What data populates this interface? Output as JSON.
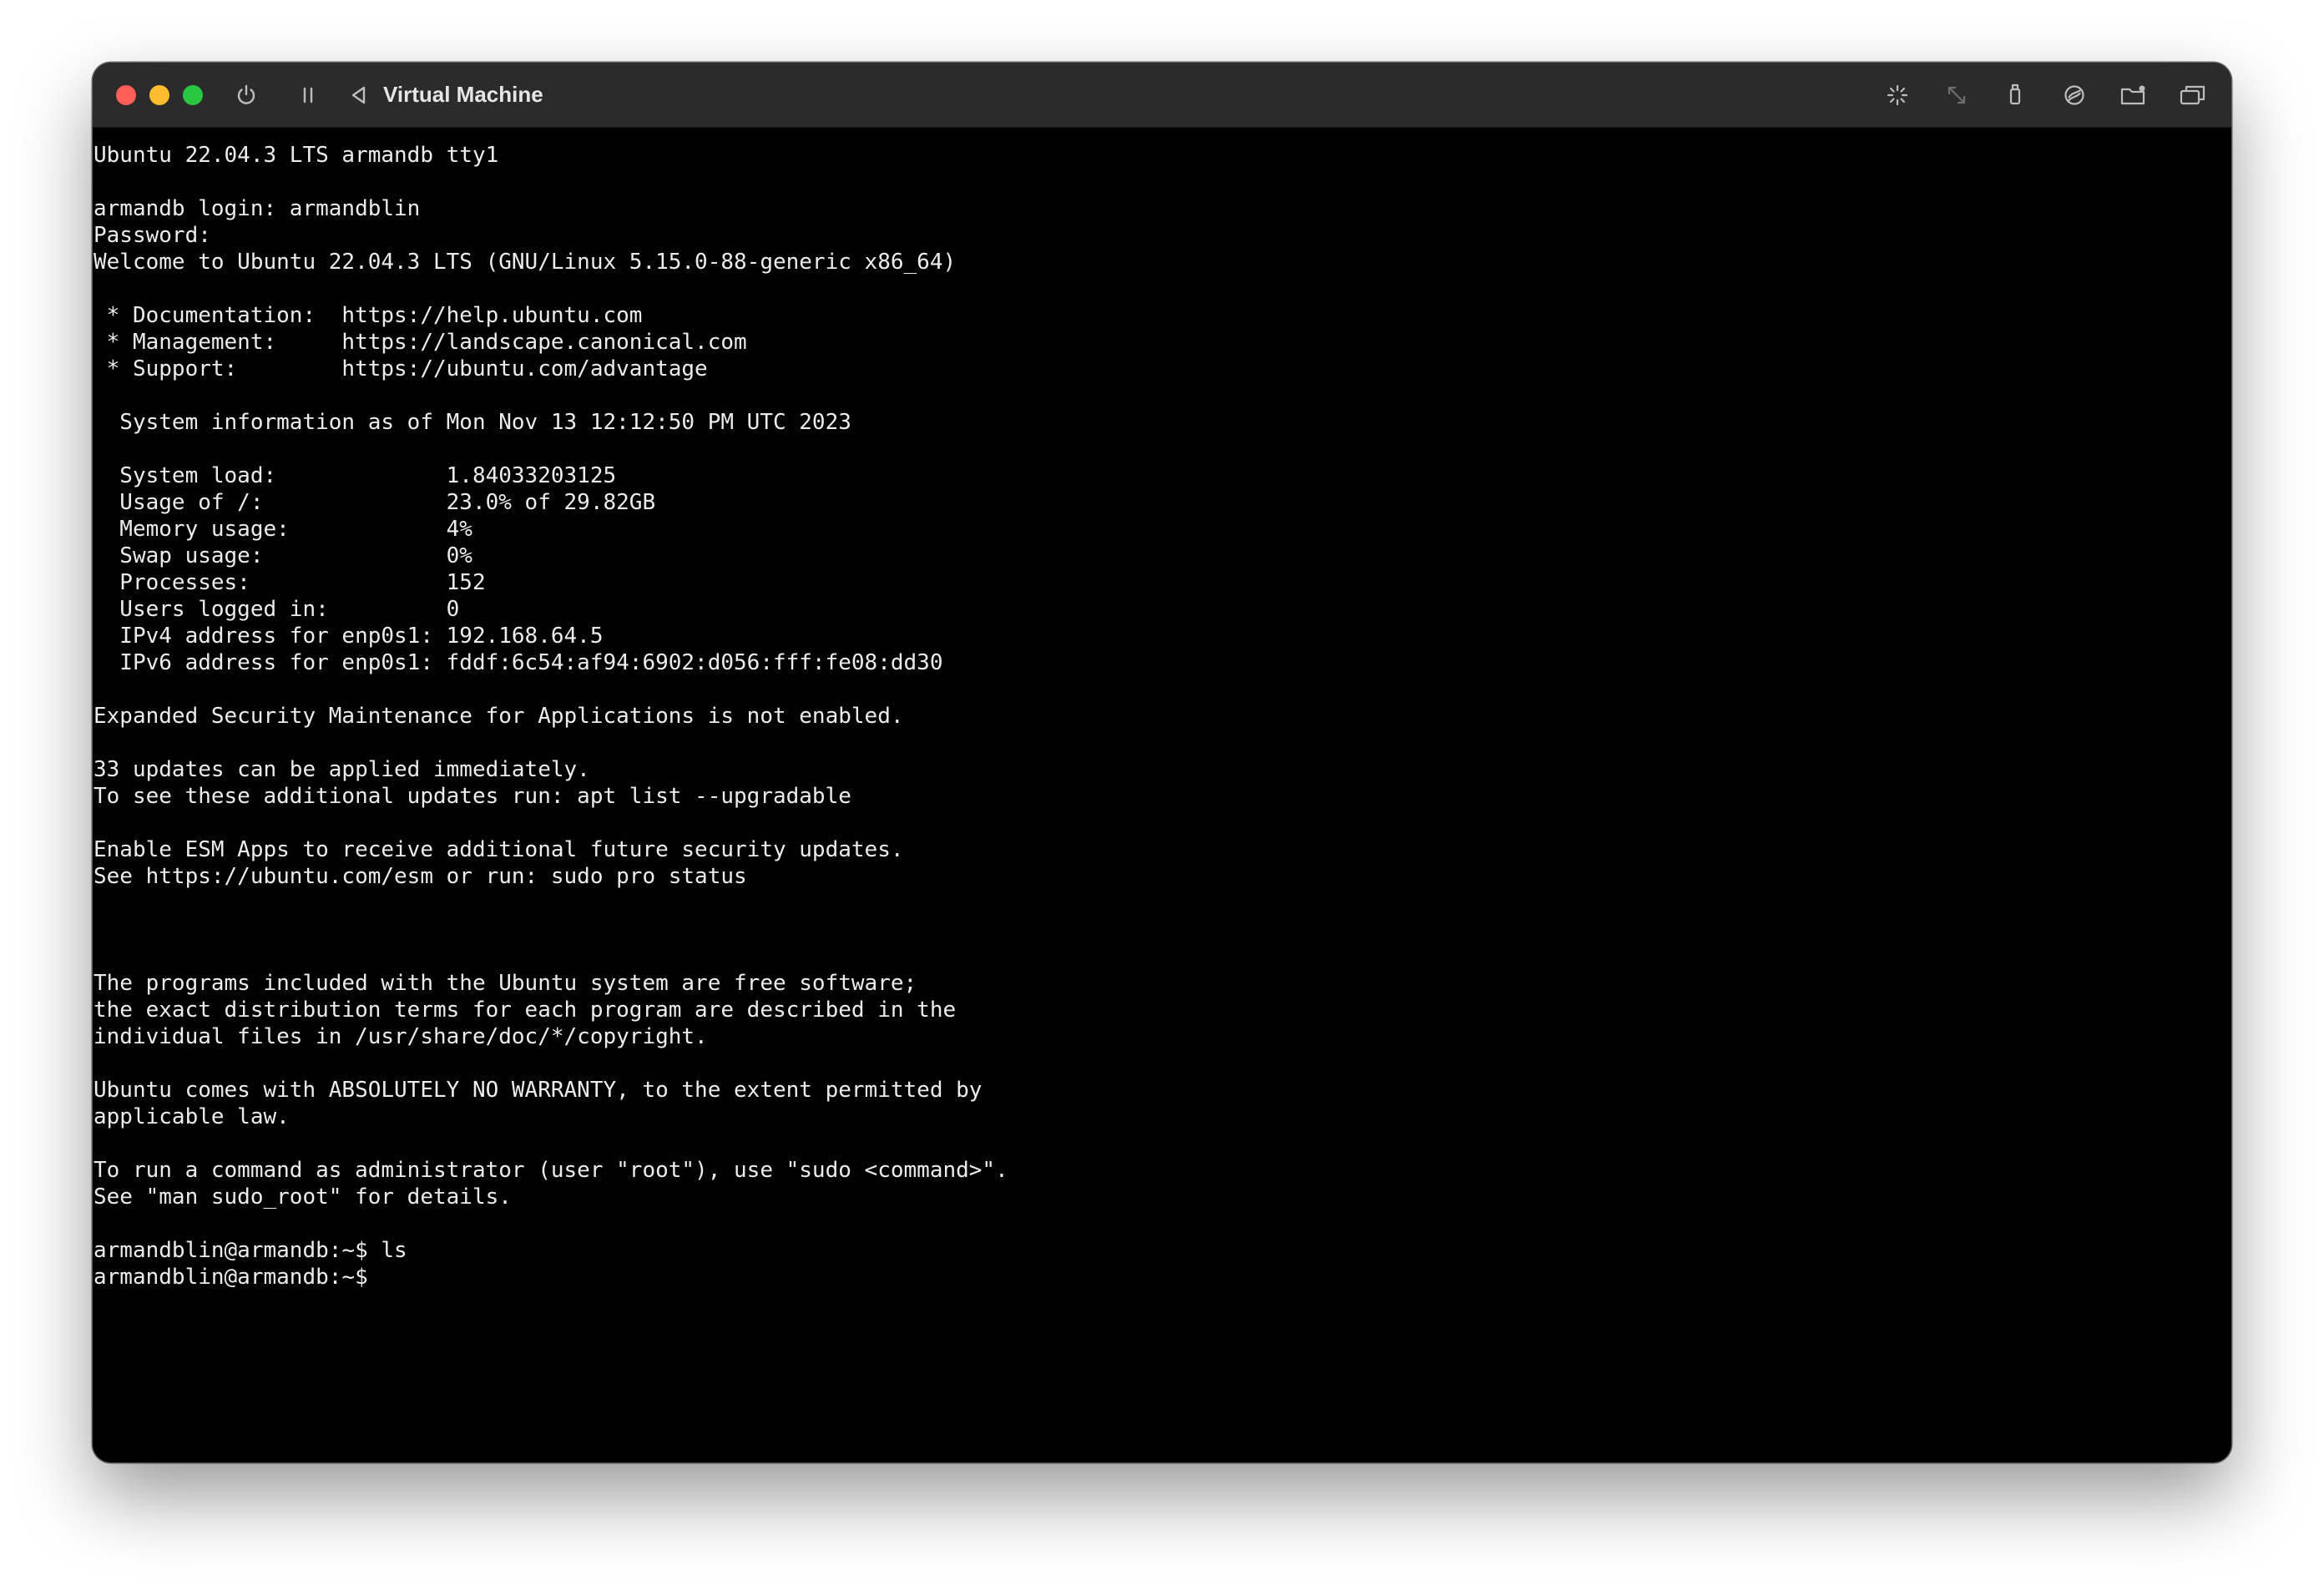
{
  "window": {
    "title": "Virtual Machine"
  },
  "toolbar": {
    "left_icons": [
      "power-icon",
      "pause-icon",
      "back-icon"
    ],
    "right_icons": [
      "brightness-icon",
      "resize-icon",
      "usb-device-icon",
      "network-icon",
      "shared-folder-icon",
      "window-tiles-icon"
    ]
  },
  "colors": {
    "terminal_bg": "#000000",
    "terminal_fg": "#ececec",
    "titlebar_bg": "#2b2b2b",
    "close": "#ff5f57",
    "minimize": "#febc2e",
    "maximize": "#28c840"
  },
  "terminal": {
    "lines": [
      "Ubuntu 22.04.3 LTS armandb tty1",
      "",
      "armandb login: armandblin",
      "Password:",
      "Welcome to Ubuntu 22.04.3 LTS (GNU/Linux 5.15.0-88-generic x86_64)",
      "",
      " * Documentation:  https://help.ubuntu.com",
      " * Management:     https://landscape.canonical.com",
      " * Support:        https://ubuntu.com/advantage",
      "",
      "  System information as of Mon Nov 13 12:12:50 PM UTC 2023",
      "",
      "  System load:             1.84033203125",
      "  Usage of /:              23.0% of 29.82GB",
      "  Memory usage:            4%",
      "  Swap usage:              0%",
      "  Processes:               152",
      "  Users logged in:         0",
      "  IPv4 address for enp0s1: 192.168.64.5",
      "  IPv6 address for enp0s1: fddf:6c54:af94:6902:d056:fff:fe08:dd30",
      "",
      "Expanded Security Maintenance for Applications is not enabled.",
      "",
      "33 updates can be applied immediately.",
      "To see these additional updates run: apt list --upgradable",
      "",
      "Enable ESM Apps to receive additional future security updates.",
      "See https://ubuntu.com/esm or run: sudo pro status",
      "",
      "",
      "",
      "The programs included with the Ubuntu system are free software;",
      "the exact distribution terms for each program are described in the",
      "individual files in /usr/share/doc/*/copyright.",
      "",
      "Ubuntu comes with ABSOLUTELY NO WARRANTY, to the extent permitted by",
      "applicable law.",
      "",
      "To run a command as administrator (user \"root\"), use \"sudo <command>\".",
      "See \"man sudo_root\" for details.",
      "",
      "armandblin@armandb:~$ ls",
      "armandblin@armandb:~$"
    ]
  }
}
